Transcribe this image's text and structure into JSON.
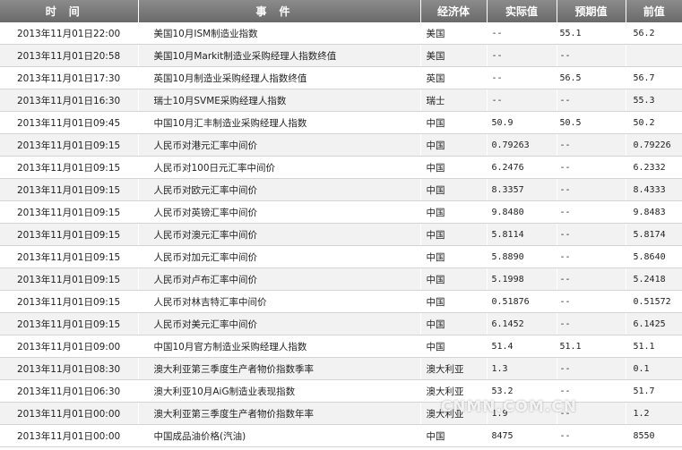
{
  "headers": {
    "time": "时间",
    "event": "事件",
    "economy": "经济体",
    "actual": "实际值",
    "forecast": "预期值",
    "previous": "前值"
  },
  "rows": [
    {
      "time": "2013年11月01日22:00",
      "event": "美国10月ISM制造业指数",
      "economy": "美国",
      "actual": "--",
      "forecast": "55.1",
      "previous": "56.2"
    },
    {
      "time": "2013年11月01日20:58",
      "event": "美国10月Markit制造业采购经理人指数终值",
      "economy": "美国",
      "actual": "--",
      "forecast": "--",
      "previous": ""
    },
    {
      "time": "2013年11月01日17:30",
      "event": "英国10月制造业采购经理人指数终值",
      "economy": "英国",
      "actual": "--",
      "forecast": "56.5",
      "previous": "56.7"
    },
    {
      "time": "2013年11月01日16:30",
      "event": "瑞士10月SVME采购经理人指数",
      "economy": "瑞士",
      "actual": "--",
      "forecast": "--",
      "previous": "55.3"
    },
    {
      "time": "2013年11月01日09:45",
      "event": "中国10月汇丰制造业采购经理人指数",
      "economy": "中国",
      "actual": "50.9",
      "forecast": "50.5",
      "previous": "50.2"
    },
    {
      "time": "2013年11月01日09:15",
      "event": "人民币对港元汇率中间价",
      "economy": "中国",
      "actual": "0.79263",
      "forecast": "--",
      "previous": "0.79226"
    },
    {
      "time": "2013年11月01日09:15",
      "event": "人民币对100日元汇率中间价",
      "economy": "中国",
      "actual": "6.2476",
      "forecast": "--",
      "previous": "6.2332"
    },
    {
      "time": "2013年11月01日09:15",
      "event": "人民币对欧元汇率中间价",
      "economy": "中国",
      "actual": "8.3357",
      "forecast": "--",
      "previous": "8.4333"
    },
    {
      "time": "2013年11月01日09:15",
      "event": "人民币对英镑汇率中间价",
      "economy": "中国",
      "actual": "9.8480",
      "forecast": "--",
      "previous": "9.8483"
    },
    {
      "time": "2013年11月01日09:15",
      "event": "人民币对澳元汇率中间价",
      "economy": "中国",
      "actual": "5.8114",
      "forecast": "--",
      "previous": "5.8174"
    },
    {
      "time": "2013年11月01日09:15",
      "event": "人民币对加元汇率中间价",
      "economy": "中国",
      "actual": "5.8890",
      "forecast": "--",
      "previous": "5.8640"
    },
    {
      "time": "2013年11月01日09:15",
      "event": "人民币对卢布汇率中间价",
      "economy": "中国",
      "actual": "5.1998",
      "forecast": "--",
      "previous": "5.2418"
    },
    {
      "time": "2013年11月01日09:15",
      "event": "人民币对林吉特汇率中间价",
      "economy": "中国",
      "actual": "0.51876",
      "forecast": "--",
      "previous": "0.51572"
    },
    {
      "time": "2013年11月01日09:15",
      "event": "人民币对美元汇率中间价",
      "economy": "中国",
      "actual": "6.1452",
      "forecast": "--",
      "previous": "6.1425"
    },
    {
      "time": "2013年11月01日09:00",
      "event": "中国10月官方制造业采购经理人指数",
      "economy": "中国",
      "actual": "51.4",
      "forecast": "51.1",
      "previous": "51.1"
    },
    {
      "time": "2013年11月01日08:30",
      "event": "澳大利亚第三季度生产者物价指数季率",
      "economy": "澳大利亚",
      "actual": "1.3",
      "forecast": "--",
      "previous": "0.1"
    },
    {
      "time": "2013年11月01日06:30",
      "event": "澳大利亚10月AiG制造业表现指数",
      "economy": "澳大利亚",
      "actual": "53.2",
      "forecast": "--",
      "previous": "51.7"
    },
    {
      "time": "2013年11月01日00:00",
      "event": "澳大利亚第三季度生产者物价指数年率",
      "economy": "澳大利亚",
      "actual": "1.9",
      "forecast": "--",
      "previous": "1.2"
    },
    {
      "time": "2013年11月01日00:00",
      "event": "中国成品油价格(汽油)",
      "economy": "中国",
      "actual": "8475",
      "forecast": "--",
      "previous": "8550"
    }
  ],
  "watermark": "CNMN.COM.CN"
}
